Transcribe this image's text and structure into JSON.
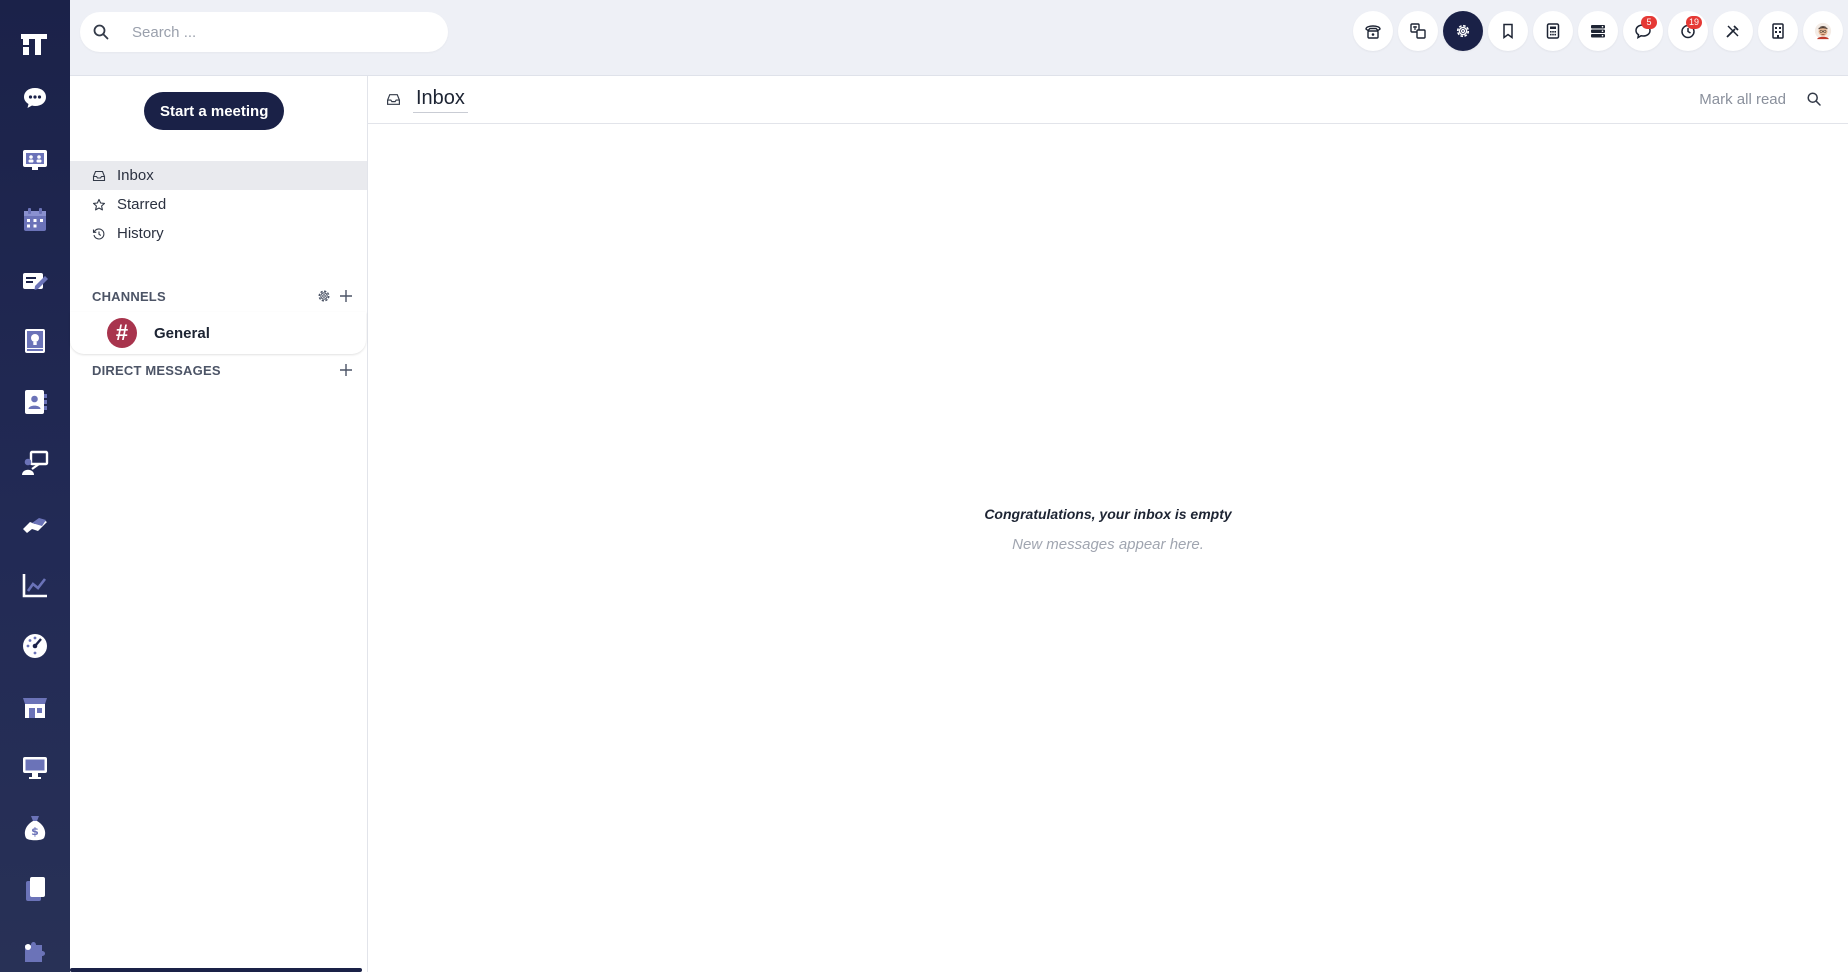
{
  "search": {
    "placeholder": "Search ..."
  },
  "rail": {
    "items": [
      {
        "icon": "chat-bubble-icon"
      },
      {
        "icon": "team-board-icon"
      },
      {
        "icon": "calendar-icon"
      },
      {
        "icon": "notes-icon"
      },
      {
        "icon": "knowledge-icon"
      },
      {
        "icon": "contacts-icon"
      },
      {
        "icon": "presenter-icon"
      },
      {
        "icon": "handshake-icon"
      },
      {
        "icon": "chart-icon"
      },
      {
        "icon": "dashboard-gauge-icon"
      },
      {
        "icon": "shop-icon"
      },
      {
        "icon": "monitor-icon"
      },
      {
        "icon": "money-bag-icon"
      },
      {
        "icon": "documents-icon"
      },
      {
        "icon": "puzzle-icon"
      }
    ]
  },
  "topbar": {
    "notification_badge": "5",
    "activity_badge": "19"
  },
  "sidebar": {
    "meeting_button": "Start a meeting",
    "nav": {
      "inbox": "Inbox",
      "starred": "Starred",
      "history": "History"
    },
    "channels_heading": "CHANNELS",
    "channels": [
      {
        "name": "General"
      }
    ],
    "dm_heading": "DIRECT MESSAGES"
  },
  "main": {
    "title": "Inbox",
    "mark_all_read": "Mark all read",
    "empty_title": "Congratulations, your inbox is empty",
    "empty_subtitle": "New messages appear here."
  },
  "colors": {
    "rail": "#1b2249",
    "accent": "#1a2147",
    "badge": "#e53935",
    "channel_avatar": "#a8344d",
    "rail_icon": "#ffffff",
    "rail_icon_tint": "#6b73b8"
  }
}
